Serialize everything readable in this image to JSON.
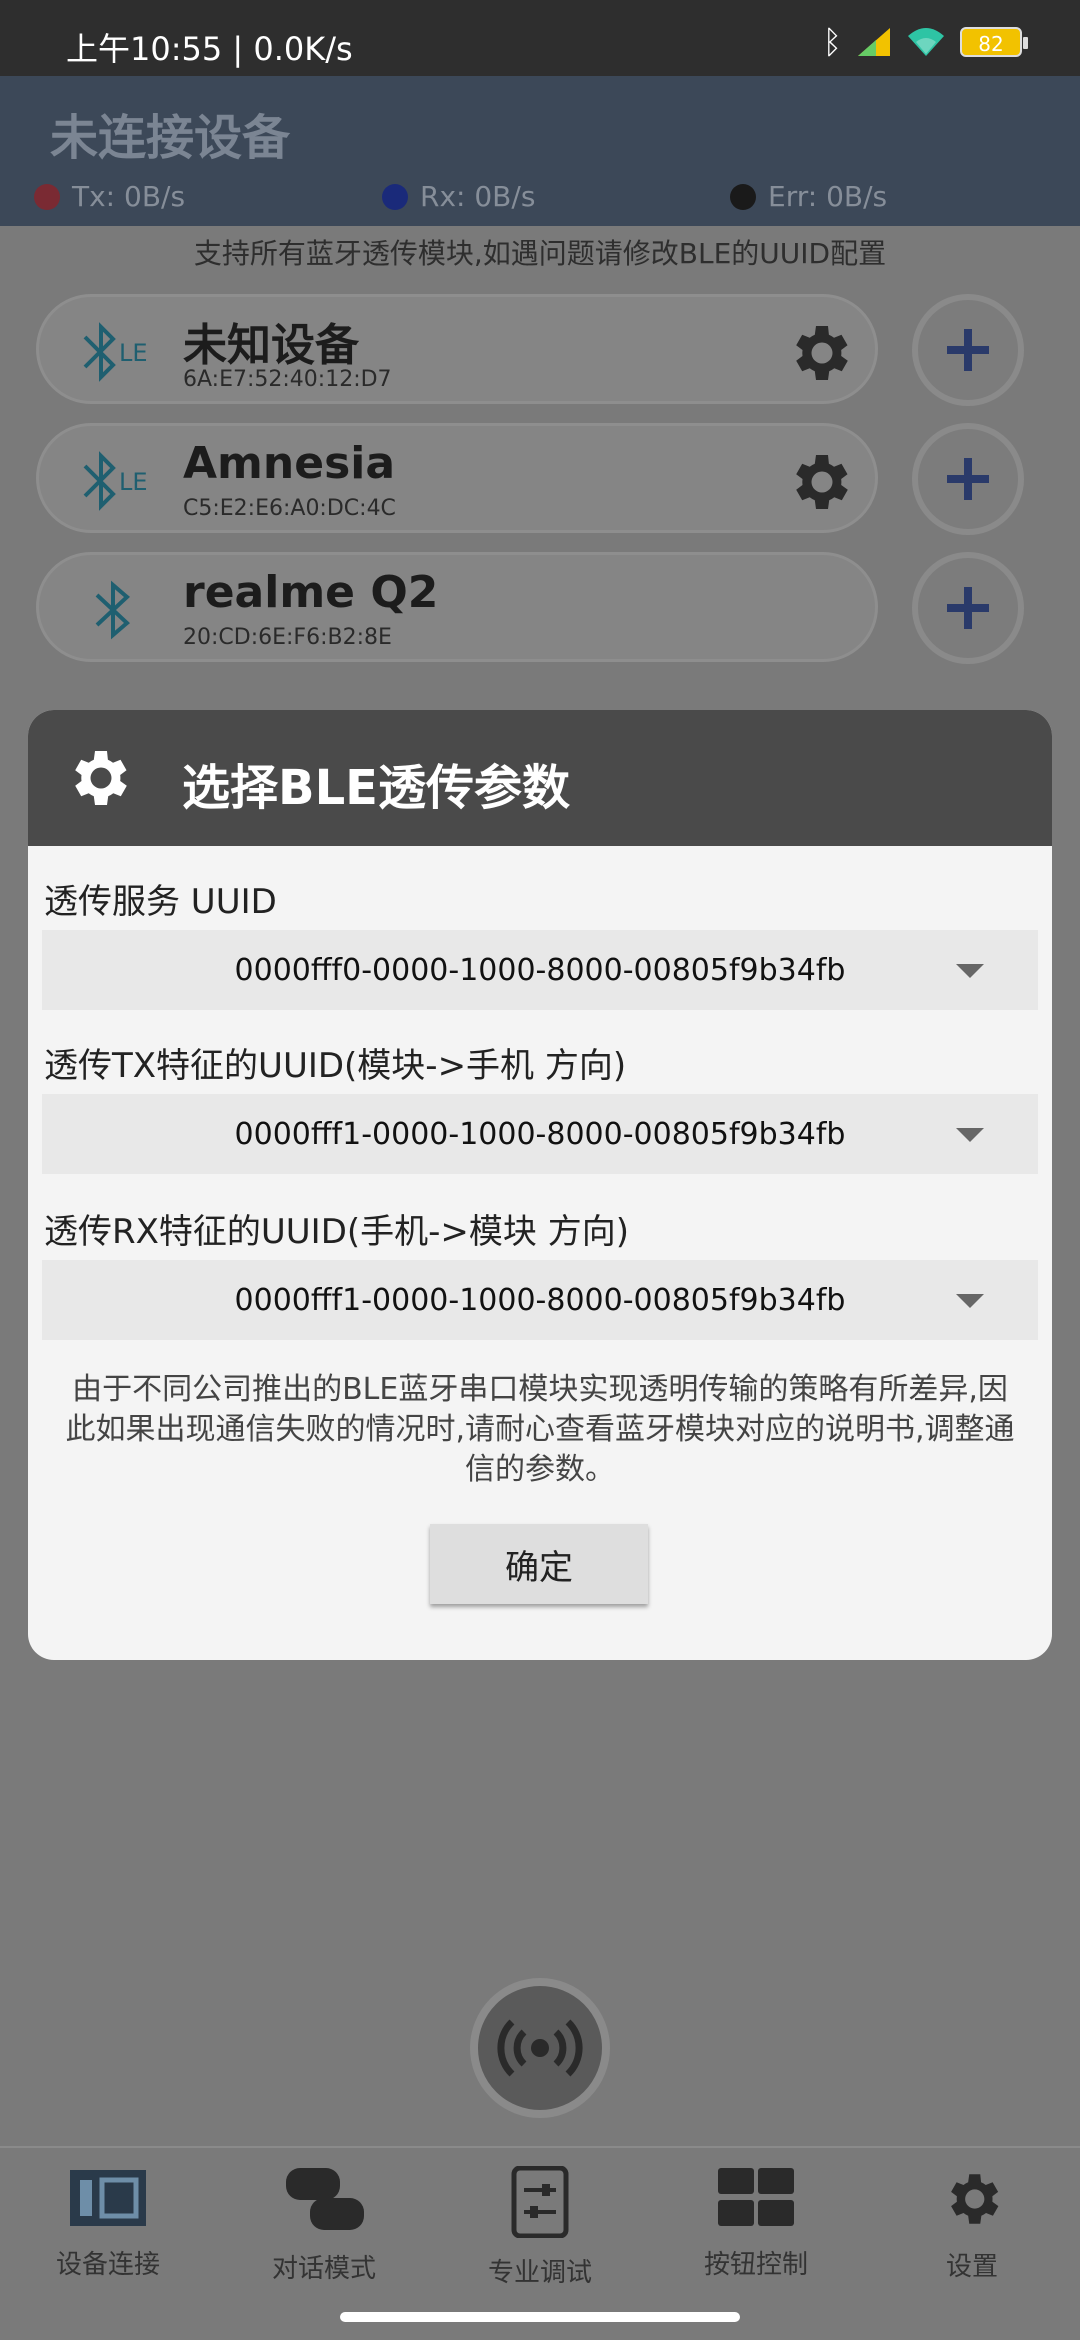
{
  "status_bar": {
    "time": "上午10:55 | 0.0K/s",
    "battery": "82"
  },
  "header": {
    "title": "未连接设备",
    "stats": [
      {
        "label": "Tx: 0B/s",
        "color": "#7a2a33"
      },
      {
        "label": "Rx: 0B/s",
        "color": "#1a2a7a"
      },
      {
        "label": "Err: 0B/s",
        "color": "#1a1a1a"
      }
    ]
  },
  "hint": "支持所有蓝牙透传模块,如遇问题请修改BLE的UUID配置",
  "devices": [
    {
      "name": "未知设备",
      "mac": "6A:E7:52:40:12:D7",
      "icon": "bluetooth-le-icon"
    },
    {
      "name": "Amnesia",
      "mac": "C5:E2:E6:A0:DC:4C",
      "icon": "bluetooth-le-icon"
    },
    {
      "name": "realme Q2",
      "mac": "20:CD:6E:F6:B2:8E",
      "icon": "bluetooth-icon"
    }
  ],
  "dialog": {
    "title": "选择BLE透传参数",
    "fields": [
      {
        "label": "透传服务 UUID",
        "value": "0000fff0-0000-1000-8000-00805f9b34fb"
      },
      {
        "label": "透传TX特征的UUID(模块->手机 方向)",
        "value": "0000fff1-0000-1000-8000-00805f9b34fb"
      },
      {
        "label": "透传RX特征的UUID(手机->模块 方向)",
        "value": "0000fff1-0000-1000-8000-00805f9b34fb"
      }
    ],
    "note": "由于不同公司推出的BLE蓝牙串口模块实现透明传输的策略有所差异,因此如果出现通信失败的情况时,请耐心查看蓝牙模块对应的说明书,调整通信的参数。",
    "ok_label": "确定"
  },
  "nav": [
    {
      "label": "设备连接",
      "icon": "device-connect-icon"
    },
    {
      "label": "对话模式",
      "icon": "chat-icon"
    },
    {
      "label": "专业调试",
      "icon": "debug-icon"
    },
    {
      "label": "按钮控制",
      "icon": "button-grid-icon"
    },
    {
      "label": "设置",
      "icon": "gear-icon"
    }
  ]
}
